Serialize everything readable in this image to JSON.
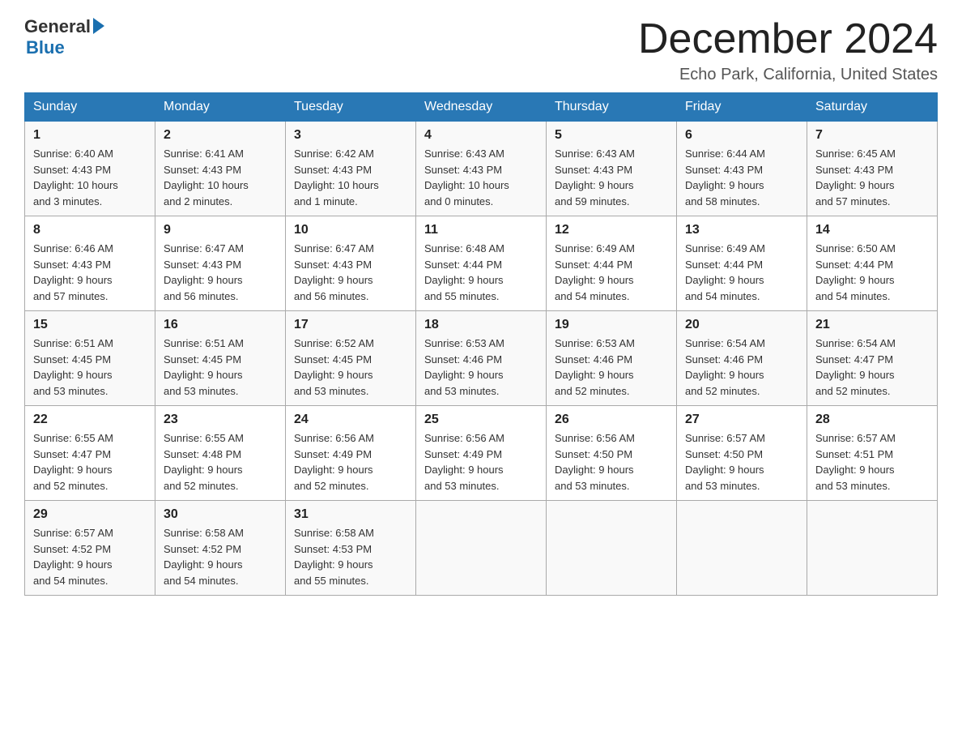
{
  "header": {
    "logo_general": "General",
    "logo_blue": "Blue",
    "month_title": "December 2024",
    "subtitle": "Echo Park, California, United States"
  },
  "days_of_week": [
    "Sunday",
    "Monday",
    "Tuesday",
    "Wednesday",
    "Thursday",
    "Friday",
    "Saturday"
  ],
  "weeks": [
    [
      {
        "day": "1",
        "sunrise": "6:40 AM",
        "sunset": "4:43 PM",
        "daylight": "10 hours and 3 minutes."
      },
      {
        "day": "2",
        "sunrise": "6:41 AM",
        "sunset": "4:43 PM",
        "daylight": "10 hours and 2 minutes."
      },
      {
        "day": "3",
        "sunrise": "6:42 AM",
        "sunset": "4:43 PM",
        "daylight": "10 hours and 1 minute."
      },
      {
        "day": "4",
        "sunrise": "6:43 AM",
        "sunset": "4:43 PM",
        "daylight": "10 hours and 0 minutes."
      },
      {
        "day": "5",
        "sunrise": "6:43 AM",
        "sunset": "4:43 PM",
        "daylight": "9 hours and 59 minutes."
      },
      {
        "day": "6",
        "sunrise": "6:44 AM",
        "sunset": "4:43 PM",
        "daylight": "9 hours and 58 minutes."
      },
      {
        "day": "7",
        "sunrise": "6:45 AM",
        "sunset": "4:43 PM",
        "daylight": "9 hours and 57 minutes."
      }
    ],
    [
      {
        "day": "8",
        "sunrise": "6:46 AM",
        "sunset": "4:43 PM",
        "daylight": "9 hours and 57 minutes."
      },
      {
        "day": "9",
        "sunrise": "6:47 AM",
        "sunset": "4:43 PM",
        "daylight": "9 hours and 56 minutes."
      },
      {
        "day": "10",
        "sunrise": "6:47 AM",
        "sunset": "4:43 PM",
        "daylight": "9 hours and 56 minutes."
      },
      {
        "day": "11",
        "sunrise": "6:48 AM",
        "sunset": "4:44 PM",
        "daylight": "9 hours and 55 minutes."
      },
      {
        "day": "12",
        "sunrise": "6:49 AM",
        "sunset": "4:44 PM",
        "daylight": "9 hours and 54 minutes."
      },
      {
        "day": "13",
        "sunrise": "6:49 AM",
        "sunset": "4:44 PM",
        "daylight": "9 hours and 54 minutes."
      },
      {
        "day": "14",
        "sunrise": "6:50 AM",
        "sunset": "4:44 PM",
        "daylight": "9 hours and 54 minutes."
      }
    ],
    [
      {
        "day": "15",
        "sunrise": "6:51 AM",
        "sunset": "4:45 PM",
        "daylight": "9 hours and 53 minutes."
      },
      {
        "day": "16",
        "sunrise": "6:51 AM",
        "sunset": "4:45 PM",
        "daylight": "9 hours and 53 minutes."
      },
      {
        "day": "17",
        "sunrise": "6:52 AM",
        "sunset": "4:45 PM",
        "daylight": "9 hours and 53 minutes."
      },
      {
        "day": "18",
        "sunrise": "6:53 AM",
        "sunset": "4:46 PM",
        "daylight": "9 hours and 53 minutes."
      },
      {
        "day": "19",
        "sunrise": "6:53 AM",
        "sunset": "4:46 PM",
        "daylight": "9 hours and 52 minutes."
      },
      {
        "day": "20",
        "sunrise": "6:54 AM",
        "sunset": "4:46 PM",
        "daylight": "9 hours and 52 minutes."
      },
      {
        "day": "21",
        "sunrise": "6:54 AM",
        "sunset": "4:47 PM",
        "daylight": "9 hours and 52 minutes."
      }
    ],
    [
      {
        "day": "22",
        "sunrise": "6:55 AM",
        "sunset": "4:47 PM",
        "daylight": "9 hours and 52 minutes."
      },
      {
        "day": "23",
        "sunrise": "6:55 AM",
        "sunset": "4:48 PM",
        "daylight": "9 hours and 52 minutes."
      },
      {
        "day": "24",
        "sunrise": "6:56 AM",
        "sunset": "4:49 PM",
        "daylight": "9 hours and 52 minutes."
      },
      {
        "day": "25",
        "sunrise": "6:56 AM",
        "sunset": "4:49 PM",
        "daylight": "9 hours and 53 minutes."
      },
      {
        "day": "26",
        "sunrise": "6:56 AM",
        "sunset": "4:50 PM",
        "daylight": "9 hours and 53 minutes."
      },
      {
        "day": "27",
        "sunrise": "6:57 AM",
        "sunset": "4:50 PM",
        "daylight": "9 hours and 53 minutes."
      },
      {
        "day": "28",
        "sunrise": "6:57 AM",
        "sunset": "4:51 PM",
        "daylight": "9 hours and 53 minutes."
      }
    ],
    [
      {
        "day": "29",
        "sunrise": "6:57 AM",
        "sunset": "4:52 PM",
        "daylight": "9 hours and 54 minutes."
      },
      {
        "day": "30",
        "sunrise": "6:58 AM",
        "sunset": "4:52 PM",
        "daylight": "9 hours and 54 minutes."
      },
      {
        "day": "31",
        "sunrise": "6:58 AM",
        "sunset": "4:53 PM",
        "daylight": "9 hours and 55 minutes."
      },
      null,
      null,
      null,
      null
    ]
  ],
  "labels": {
    "sunrise": "Sunrise:",
    "sunset": "Sunset:",
    "daylight": "Daylight:"
  }
}
